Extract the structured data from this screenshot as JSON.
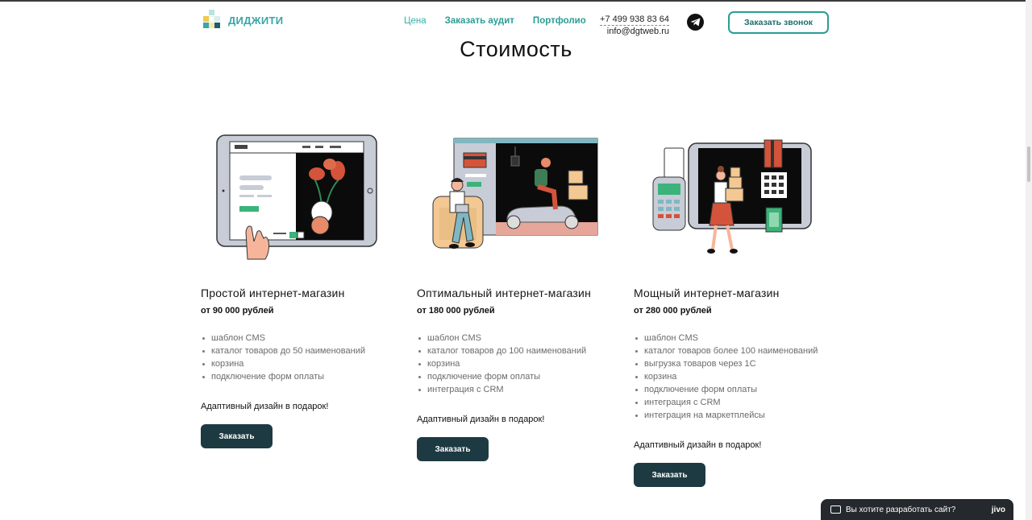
{
  "header": {
    "logo_text": "ДИДЖИТИ",
    "nav": [
      "Цена",
      "Заказать аудит",
      "Портфолио"
    ],
    "phone": "+7 499 938 83 64",
    "email": "info@dgtweb.ru",
    "call_button": "Заказать звонок"
  },
  "page_title": "Стоимость",
  "cards": [
    {
      "title": "Простой интернет-магазин",
      "price": "от 90 000 рублей",
      "features": [
        "шаблон CMS",
        "каталог товаров до 50 наименований",
        "корзина",
        "подключение форм оплаты"
      ],
      "gift": "Адаптивный дизайн в подарок!",
      "button": "Заказать"
    },
    {
      "title": "Оптимальный интернет-магазин",
      "price": "от 180 000 рублей",
      "features": [
        "шаблон CMS",
        "каталог товаров до 100 наименований",
        "корзина",
        "подключение форм оплаты",
        "интеграция с CRM"
      ],
      "gift": "Адаптивный дизайн в подарок!",
      "button": "Заказать"
    },
    {
      "title": "Мощный интернет-магазин",
      "price": "от 280 000 рублей",
      "features": [
        "шаблон CMS",
        "каталог товаров более 100 наименований",
        "выгрузка товаров через 1С",
        "корзина",
        "подключение форм оплаты",
        "интеграция с CRM",
        "интеграция на маркетплейсы"
      ],
      "gift": "Адаптивный дизайн в подарок!",
      "button": "Заказать"
    }
  ],
  "chat_widget": {
    "text": "Вы хотите разработать сайт?",
    "brand": "jivo"
  },
  "colors": {
    "accent": "#2a9d95",
    "button_dark": "#1d3a42",
    "title": "#111111"
  }
}
